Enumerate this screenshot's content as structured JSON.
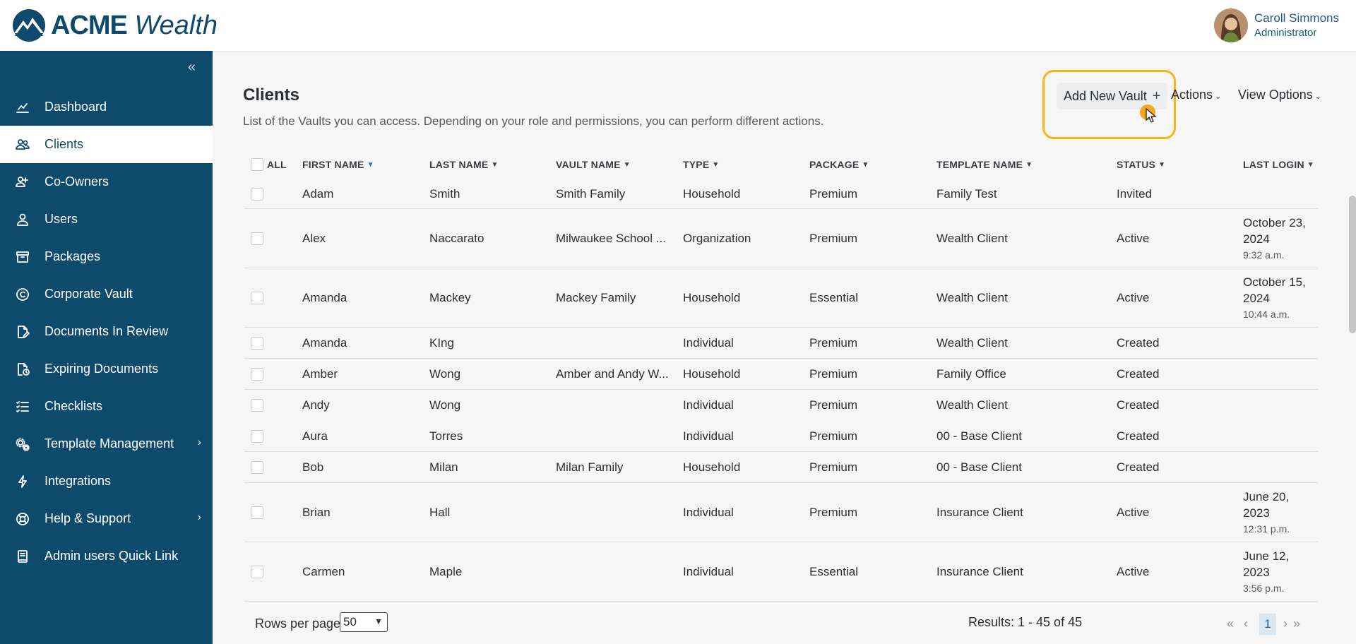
{
  "brand": {
    "name_bold": "ACME",
    "name_italic": "Wealth"
  },
  "user": {
    "name": "Caroll Simmons",
    "role": "Administrator"
  },
  "sidebar": {
    "collapse_icon": "double-chevron-left-icon",
    "items": [
      {
        "label": "Dashboard",
        "icon": "chart-icon",
        "active": false
      },
      {
        "label": "Clients",
        "icon": "people-icon",
        "active": true
      },
      {
        "label": "Co-Owners",
        "icon": "co-owners-icon",
        "active": false
      },
      {
        "label": "Users",
        "icon": "user-icon",
        "active": false
      },
      {
        "label": "Packages",
        "icon": "package-icon",
        "active": false
      },
      {
        "label": "Corporate Vault",
        "icon": "copyright-icon",
        "active": false
      },
      {
        "label": "Documents In Review",
        "icon": "document-edit-icon",
        "active": false
      },
      {
        "label": "Expiring Documents",
        "icon": "document-clock-icon",
        "active": false
      },
      {
        "label": "Checklists",
        "icon": "checklist-icon",
        "active": false
      },
      {
        "label": "Template Management",
        "icon": "gears-icon",
        "active": false,
        "submenu": true
      },
      {
        "label": "Integrations",
        "icon": "bolt-icon",
        "active": false
      },
      {
        "label": "Help & Support",
        "icon": "lifebuoy-icon",
        "active": false,
        "submenu": true
      },
      {
        "label": "Admin users Quick Link",
        "icon": "book-icon",
        "active": false
      }
    ]
  },
  "page": {
    "title": "Clients",
    "subtitle": "List of the Vaults you can access. Depending on your role and permissions, you can perform different actions.",
    "add_button": "Add New Vault",
    "actions": "Actions",
    "view_options": "View Options"
  },
  "table": {
    "select_all": "ALL",
    "columns": [
      "FIRST NAME",
      "LAST NAME",
      "VAULT NAME",
      "TYPE",
      "PACKAGE",
      "TEMPLATE NAME",
      "STATUS",
      "LAST LOGIN"
    ],
    "rows": [
      {
        "first": "Adam",
        "last": "Smith",
        "vault": "Smith Family",
        "type": "Household",
        "package": "Premium",
        "template": "Family Test",
        "status": "Invited",
        "login_date": "",
        "login_time": ""
      },
      {
        "first": "Alex",
        "last": "Naccarato",
        "vault": "Milwaukee School ...",
        "type": "Organization",
        "package": "Premium",
        "template": "Wealth Client",
        "status": "Active",
        "login_date": "October 23, 2024",
        "login_time": "9:32 a.m."
      },
      {
        "first": "Amanda",
        "last": "Mackey",
        "vault": "Mackey Family",
        "type": "Household",
        "package": "Essential",
        "template": "Wealth Client",
        "status": "Active",
        "login_date": "October 15, 2024",
        "login_time": "10:44 a.m."
      },
      {
        "first": "Amanda",
        "last": "KIng",
        "vault": "",
        "type": "Individual",
        "package": "Premium",
        "template": "Wealth Client",
        "status": "Created",
        "login_date": "",
        "login_time": ""
      },
      {
        "first": "Amber",
        "last": "Wong",
        "vault": "Amber and Andy W...",
        "type": "Household",
        "package": "Premium",
        "template": "Family Office",
        "status": "Created",
        "login_date": "",
        "login_time": ""
      },
      {
        "first": "Andy",
        "last": "Wong",
        "vault": "",
        "type": "Individual",
        "package": "Premium",
        "template": "Wealth Client",
        "status": "Created",
        "login_date": "",
        "login_time": ""
      },
      {
        "first": "Aura",
        "last": "Torres",
        "vault": "",
        "type": "Individual",
        "package": "Premium",
        "template": "00 - Base Client",
        "status": "Created",
        "login_date": "",
        "login_time": ""
      },
      {
        "first": "Bob",
        "last": "Milan",
        "vault": "Milan Family",
        "type": "Household",
        "package": "Premium",
        "template": "00 - Base Client",
        "status": "Created",
        "login_date": "",
        "login_time": ""
      },
      {
        "first": "Brian",
        "last": "Hall",
        "vault": "",
        "type": "Individual",
        "package": "Premium",
        "template": "Insurance Client",
        "status": "Active",
        "login_date": "June 20, 2023",
        "login_time": "12:31 p.m."
      },
      {
        "first": "Carmen",
        "last": "Maple",
        "vault": "",
        "type": "Individual",
        "package": "Essential",
        "template": "Insurance Client",
        "status": "Active",
        "login_date": "June 12, 2023",
        "login_time": "3:56 p.m."
      }
    ]
  },
  "footer": {
    "rows_per_page_label": "Rows per page",
    "rows_per_page_value": "50",
    "results": "Results: 1 - 45 of 45",
    "current_page": "1"
  },
  "colors": {
    "sidebar": "#0e4a6b",
    "accent": "#1e5a86",
    "highlight": "#f4b71a"
  }
}
